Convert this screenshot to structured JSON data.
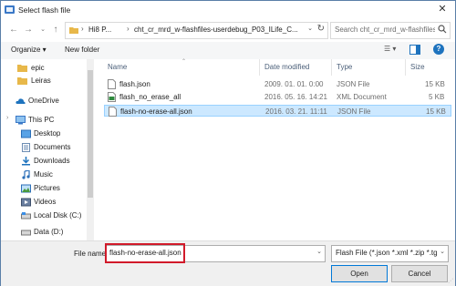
{
  "window": {
    "title": "Select flash file"
  },
  "address": {
    "segments": [
      "Hi8 P...",
      "cht_cr_mrd_w-flashfiles-userdebug_P03_ILife_C..."
    ],
    "search_placeholder": "Search cht_cr_mrd_w-flashfiles..."
  },
  "toolbar": {
    "organize": "Organize ▾",
    "new_folder": "New folder"
  },
  "nav": {
    "items": [
      {
        "label": "epic",
        "icon": "folder-icon"
      },
      {
        "label": "Leiras",
        "icon": "folder-icon"
      },
      {
        "label": "OneDrive",
        "icon": "cloud-icon"
      },
      {
        "label": "This PC",
        "icon": "computer-icon"
      },
      {
        "label": "Desktop",
        "icon": "desktop-icon"
      },
      {
        "label": "Documents",
        "icon": "documents-icon"
      },
      {
        "label": "Downloads",
        "icon": "downloads-icon"
      },
      {
        "label": "Music",
        "icon": "music-icon"
      },
      {
        "label": "Pictures",
        "icon": "pictures-icon"
      },
      {
        "label": "Videos",
        "icon": "videos-icon"
      },
      {
        "label": "Local Disk (C:)",
        "icon": "drive-icon"
      },
      {
        "label": "Data (D:)",
        "icon": "drive-icon"
      }
    ]
  },
  "files": {
    "columns": [
      "Name",
      "Date modified",
      "Type",
      "Size"
    ],
    "rows": [
      {
        "name": "flash.json",
        "date": "2009. 01. 01. 0:00",
        "type": "JSON File",
        "size": "15 KB",
        "selected": false
      },
      {
        "name": "flash_no_erase_all",
        "date": "2016. 05. 16. 14:21",
        "type": "XML Document",
        "size": "5 KB",
        "selected": false
      },
      {
        "name": "flash-no-erase-all.json",
        "date": "2016. 03. 21. 11:11",
        "type": "JSON File",
        "size": "15 KB",
        "selected": true
      }
    ]
  },
  "footer": {
    "filename_label": "File name:",
    "filename_value": "flash-no-erase-all.json",
    "filter_value": "Flash File (*.json *.xml *.zip *.tgz",
    "open_label": "Open",
    "cancel_label": "Cancel"
  },
  "colors": {
    "accent": "#0078d7",
    "selection": "#cce8ff",
    "highlight_box": "#d11a2a"
  }
}
